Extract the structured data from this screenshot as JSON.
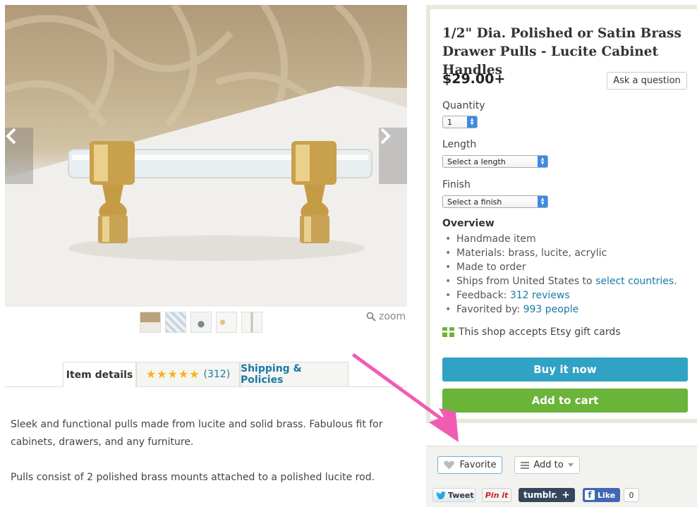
{
  "gallery": {
    "zoom_label": "zoom",
    "thumbnails": [
      "thumbnail-1",
      "thumbnail-2",
      "thumbnail-3",
      "thumbnail-4",
      "thumbnail-5"
    ]
  },
  "tabs": {
    "item_details": "Item details",
    "reviews_count": "(312)",
    "reviews_stars": 5,
    "shipping": "Shipping & Policies"
  },
  "description": {
    "para1": "Sleek and functional pulls made from lucite and solid brass. Fabulous fit for cabinets, drawers, and any furniture.",
    "para2": "Pulls consist of 2 polished brass mounts attached to a polished lucite rod."
  },
  "listing": {
    "title": "1/2\" Dia. Polished or Satin Brass Drawer Pulls - Lucite Cabinet Handles",
    "price": "$29.00+",
    "ask_button": "Ask a question",
    "quantity_label": "Quantity",
    "quantity_value": "1",
    "length_label": "Length",
    "length_placeholder": "Select a length",
    "finish_label": "Finish",
    "finish_placeholder": "Select a finish",
    "overview_heading": "Overview",
    "overview": {
      "handmade": "Handmade item",
      "materials": "Materials: brass, lucite, acrylic",
      "made_to_order": "Made to order",
      "ships_prefix": "Ships from United States to ",
      "ships_link": "select countries",
      "ships_suffix": ".",
      "feedback_prefix": "Feedback: ",
      "feedback_link": "312 reviews",
      "favorited_prefix": "Favorited by: ",
      "favorited_link": "993 people"
    },
    "gift_cards": "This shop accepts Etsy gift cards",
    "buy_now": "Buy it now",
    "add_to_cart": "Add to cart"
  },
  "social": {
    "favorite": "Favorite",
    "add_to": "Add to",
    "tweet": "Tweet",
    "pinit": "Pin it",
    "tumblr": "tumblr.",
    "like": "Like",
    "like_count": "0"
  },
  "colors": {
    "buy_now": "#30a2c4",
    "add_to_cart": "#6ab43a",
    "link": "#1a7aa6",
    "star": "#f6b40e",
    "annotation_arrow": "#f05cb4"
  }
}
